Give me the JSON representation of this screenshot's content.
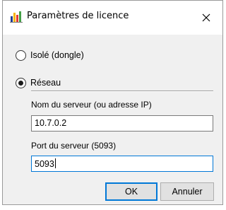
{
  "window": {
    "title": "Paramètres de licence",
    "close_label": "Fermer"
  },
  "options": {
    "isole_label": "Isolé (dongle)",
    "reseau_label": "Réseau",
    "selected": "reseau"
  },
  "server": {
    "name_label": "Nom du serveur (ou adresse IP)",
    "name_value": "10.7.0.2",
    "port_label": "Port du serveur (5093)",
    "port_value": "5093"
  },
  "buttons": {
    "ok": "OK",
    "cancel": "Annuler"
  },
  "colors": {
    "accent": "#0078d7",
    "dialog_bg": "#f0f0f0",
    "icon_bars": [
      "#1f3a93",
      "#f6b400",
      "#e53935",
      "#43a047"
    ]
  }
}
